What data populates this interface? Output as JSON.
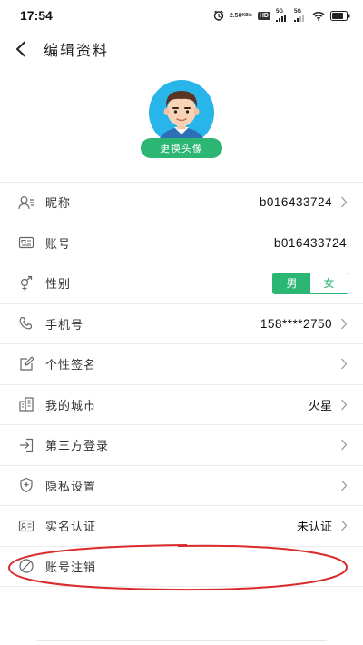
{
  "status_bar": {
    "time": "17:54",
    "net_speed_value": "2.50",
    "net_speed_unit": "KB/s",
    "hd_label": "HD",
    "sim1_label": "5G",
    "sim2_label": "5G"
  },
  "nav": {
    "title": "编辑资料"
  },
  "avatar": {
    "change_label": "更换头像"
  },
  "rows": [
    {
      "label": "昵称",
      "value": "b016433724",
      "icon": "user-id-icon",
      "chevron": true
    },
    {
      "label": "账号",
      "value": "b016433724",
      "icon": "id-card-icon",
      "chevron": false
    },
    {
      "label": "性别",
      "icon": "gender-icon",
      "gender_options": [
        "男",
        "女"
      ],
      "gender_selected": "男"
    },
    {
      "label": "手机号",
      "value": "158****2750",
      "icon": "phone-icon",
      "chevron": true
    },
    {
      "label": "个性签名",
      "value": "",
      "icon": "edit-icon",
      "chevron": true
    },
    {
      "label": "我的城市",
      "value": "火星",
      "icon": "city-icon",
      "chevron": true
    },
    {
      "label": "第三方登录",
      "value": "",
      "icon": "login-icon",
      "chevron": true
    },
    {
      "label": "隐私设置",
      "value": "",
      "icon": "shield-icon",
      "chevron": true
    },
    {
      "label": "实名认证",
      "value": "未认证",
      "icon": "realname-icon",
      "chevron": true
    },
    {
      "label": "账号注销",
      "value": "",
      "icon": "cancel-account-icon",
      "chevron": false
    }
  ],
  "colors": {
    "accent": "#2bb673",
    "highlight": "#d92b2b",
    "divider": "#ececec"
  }
}
